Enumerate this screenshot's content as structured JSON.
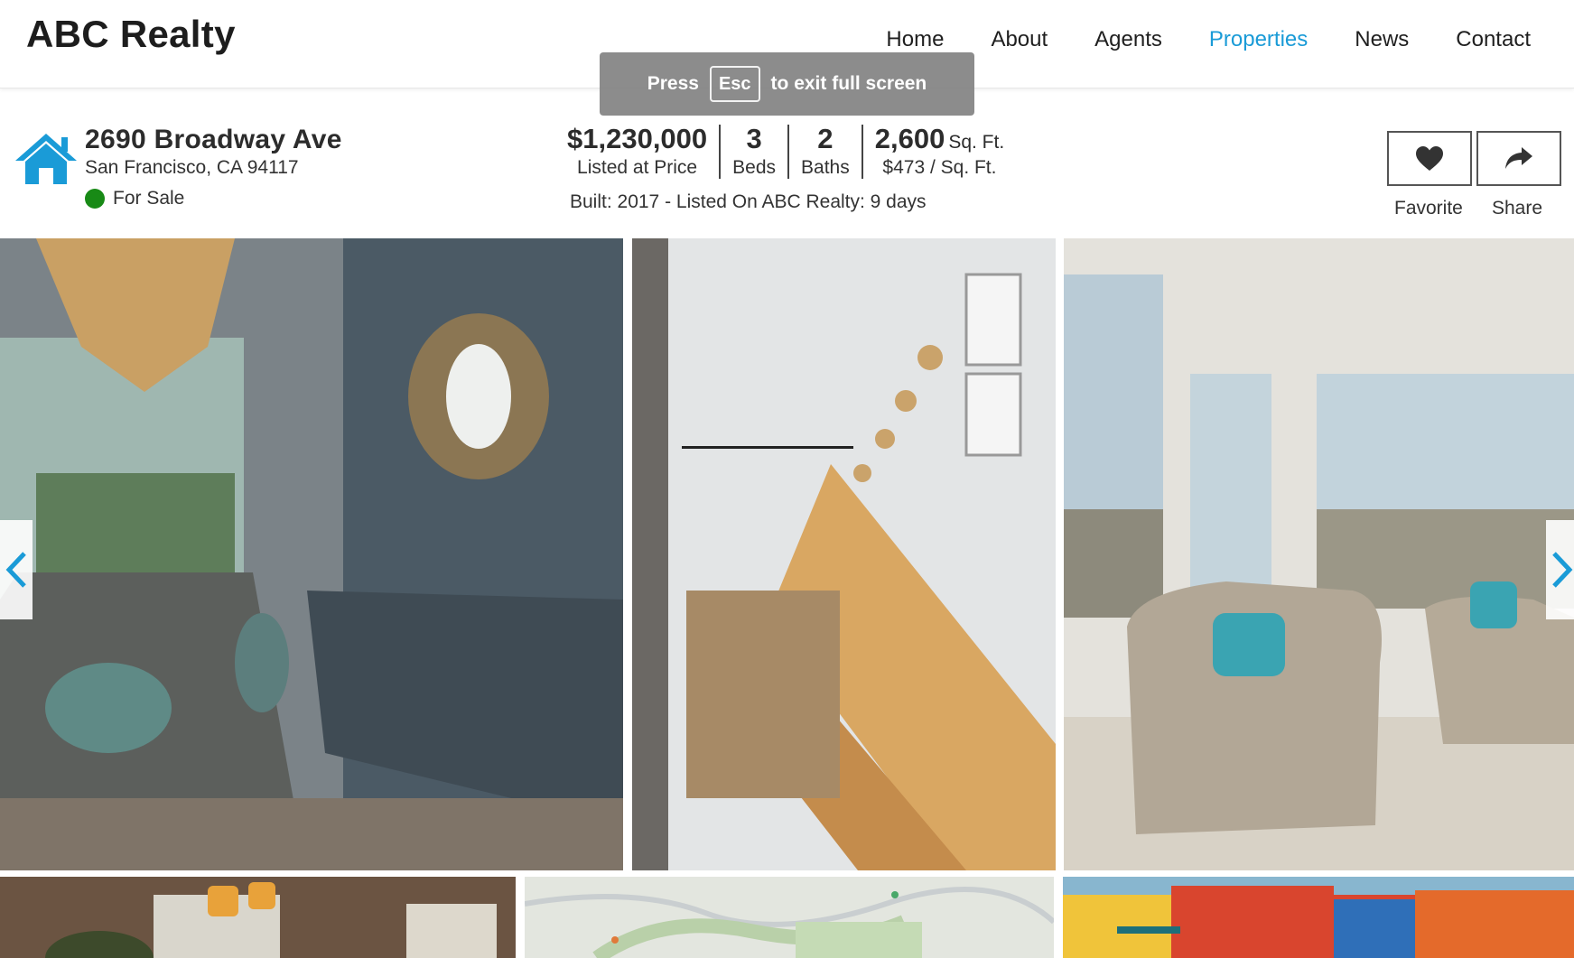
{
  "brand": "ABC Realty",
  "nav": {
    "items": [
      "Home",
      "About",
      "Agents",
      "Properties",
      "News",
      "Contact"
    ],
    "active": "Properties",
    "accent_color": "#1a9bd7"
  },
  "fullscreen_notice": {
    "before": "Press",
    "key": "Esc",
    "after": "to exit full screen"
  },
  "listing": {
    "icon": "home-icon",
    "icon_color": "#1a9bd7",
    "address": "2690 Broadway Ave",
    "city_state_zip": "San Francisco, CA 94117",
    "status": "For Sale",
    "status_color": "#188a16",
    "price": "$1,230,000",
    "price_label": "Listed at Price",
    "beds": "3",
    "beds_label": "Beds",
    "baths": "2",
    "baths_label": "Baths",
    "sqft": "2,600",
    "sqft_unit": "Sq. Ft.",
    "price_per_sqft": "$473 / Sq. Ft.",
    "built_info": "Built: 2017 - Listed On ABC Realty: 9 days"
  },
  "actions": {
    "favorite_label": "Favorite",
    "favorite_icon": "heart-icon",
    "share_label": "Share",
    "share_icon": "share-icon"
  },
  "gallery": {
    "photos": [
      "dining-room-photo",
      "staircase-photo",
      "living-room-photo"
    ],
    "thumbnails": [
      "kitchen-thumbnail",
      "map-thumbnail",
      "exterior-thumbnail"
    ],
    "prev_icon": "chevron-left-icon",
    "next_icon": "chevron-right-icon",
    "arrow_color": "#1a9bd7"
  }
}
